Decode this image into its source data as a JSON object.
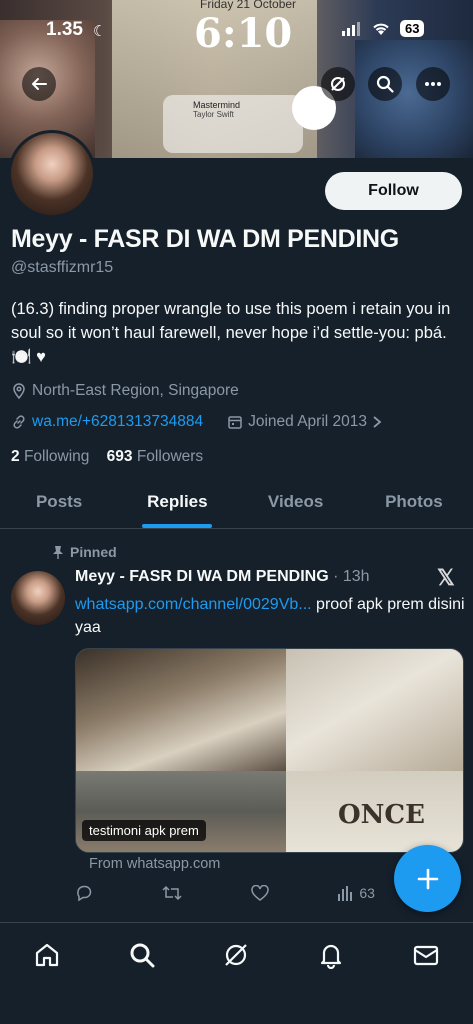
{
  "status_bar": {
    "time": "1.35",
    "battery": "63"
  },
  "banner": {
    "lock_date": "Friday 21 October",
    "lock_time": "6:10",
    "now_playing_title": "Mastermind",
    "now_playing_artist": "Taylor Swift",
    "icons": [
      "back-arrow-icon",
      "grok-icon",
      "search-icon",
      "more-icon"
    ]
  },
  "profile": {
    "follow_label": "Follow",
    "display_name": "Meyy - FASR DI WA DM PENDING",
    "handle": "@stasffizmr15",
    "bio": "(16.3) finding proper wrangle to use this poem i retain you in soul so it won’t haul farewell, never hope i’d settle-you: pbá. 🍽️ ♥",
    "location": "North-East Region, Singapore",
    "website": "wa.me/+6281313734884",
    "joined": "Joined April 2013",
    "following_count": "2",
    "following_label": "Following",
    "followers_count": "693",
    "followers_label": "Followers"
  },
  "tabs": [
    {
      "label": "Posts",
      "active": false
    },
    {
      "label": "Replies",
      "active": true
    },
    {
      "label": "Videos",
      "active": false
    },
    {
      "label": "Photos",
      "active": false
    }
  ],
  "tweet": {
    "pinned_label": "Pinned",
    "author_name": "Meyy - FASR DI WA DM PENDING",
    "time": "· 13h",
    "link_text": "whatsapp.com/channel/0029Vb...",
    "text_after_link": " proof apk prem disini yaa",
    "media_caption": "testimoni apk prem",
    "media_word": "ONCE",
    "source": "From whatsapp.com",
    "views": "63"
  },
  "colors": {
    "background": "#15202b",
    "accent": "#1d9bf0",
    "secondary_text": "#8b98a5"
  }
}
